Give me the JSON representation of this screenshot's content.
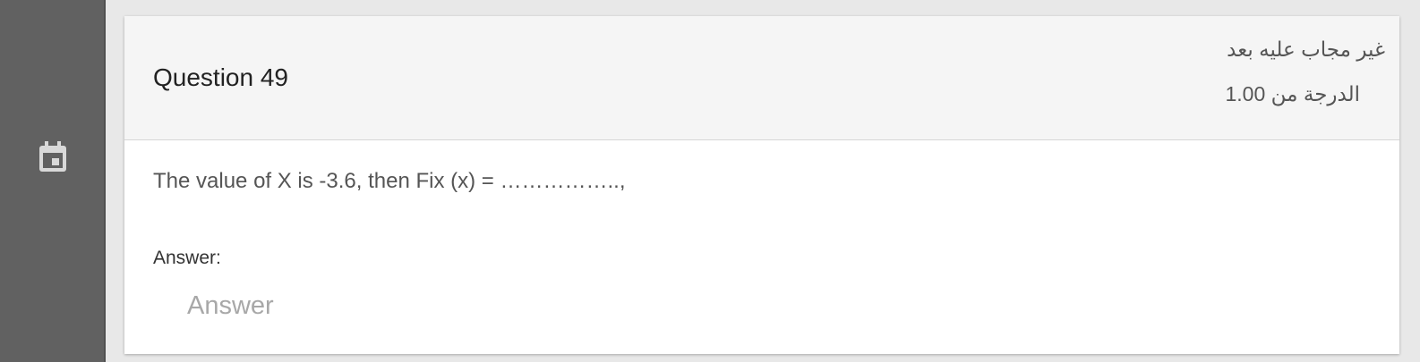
{
  "sidebar": {
    "icon": "calendar-icon"
  },
  "question": {
    "title": "Question 49",
    "state": "غير مجاب عليه بعد",
    "grade": "الدرجة من 1.00",
    "text": "The value of X is -3.6, then Fix (x) = ……………..,"
  },
  "answer": {
    "label": "Answer:",
    "placeholder": "Answer",
    "value": ""
  },
  "colors": {
    "sidebar_bg": "#616161",
    "header_bg": "#f5f5f5",
    "page_bg": "#e8e8e8",
    "card_bg": "#ffffff"
  }
}
